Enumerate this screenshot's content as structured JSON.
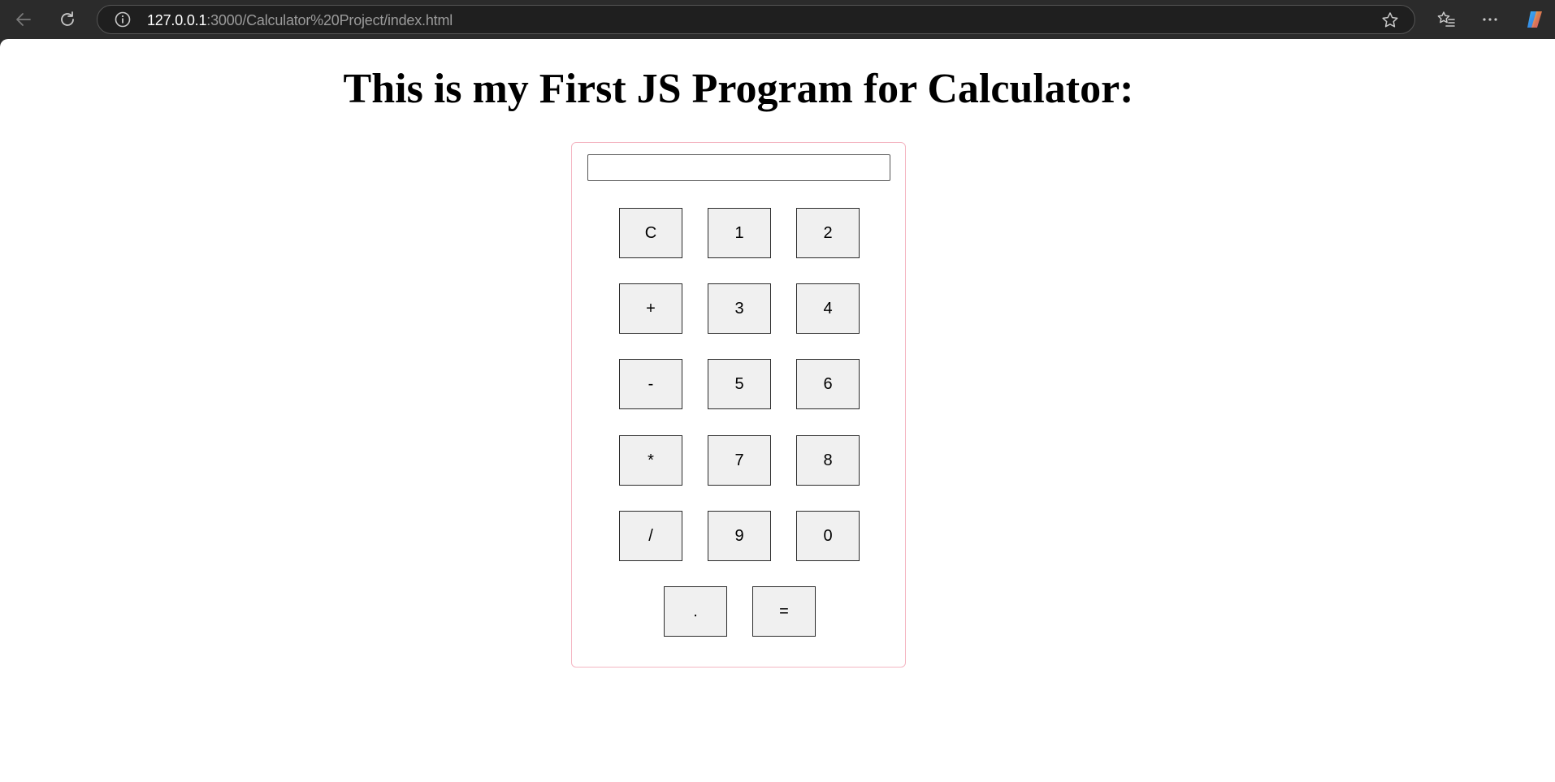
{
  "browser": {
    "url_host": "127.0.0.1",
    "url_rest": ":3000/Calculator%20Project/index.html",
    "icons": {
      "back": "back-arrow-icon",
      "reload": "reload-icon",
      "info": "info-icon",
      "star": "star-icon",
      "favorites": "favorites-icon",
      "more": "more-icon",
      "copilot": "copilot-icon"
    }
  },
  "page": {
    "title": "This is my First JS Program for Calculator:",
    "display_value": "",
    "border_color": "#f4b6c2"
  },
  "keys": [
    "C",
    "1",
    "2",
    "+",
    "3",
    "4",
    "-",
    "5",
    "6",
    "*",
    "7",
    "8",
    "/",
    "9",
    "0",
    ".",
    "="
  ]
}
